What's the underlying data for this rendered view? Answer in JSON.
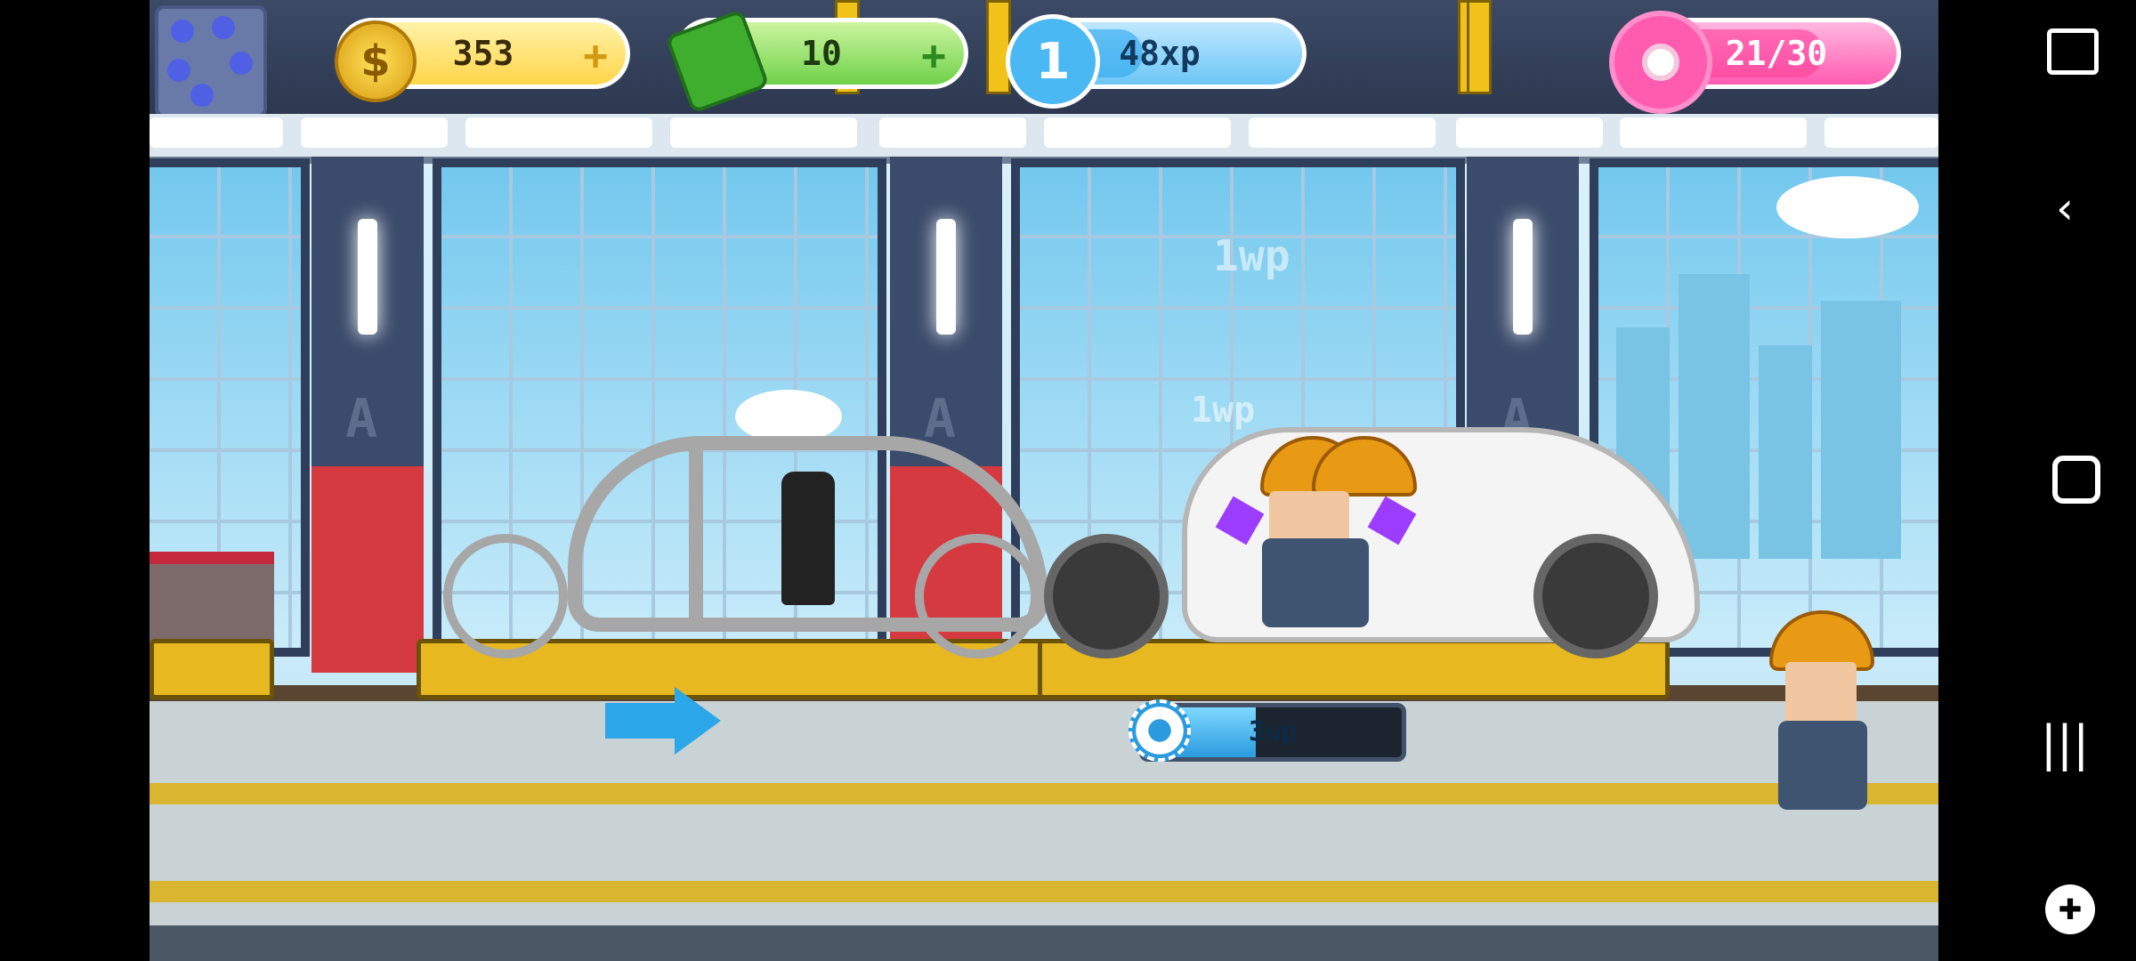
{
  "hud": {
    "coins": {
      "value": "353",
      "icon": "dollar-coin-icon",
      "plus": "+"
    },
    "cash": {
      "value": "10",
      "icon": "cash-bill-icon",
      "plus": "+"
    },
    "level": {
      "number": "1",
      "xp_label": "48xp",
      "xp_progress": 0.35
    },
    "donuts": {
      "value": "21/30",
      "progress": 0.7
    }
  },
  "world": {
    "floating_labels": [
      "1wp",
      "1wp"
    ],
    "assembly_progress": {
      "label": "3wp",
      "fraction": 0.45
    }
  },
  "colors": {
    "coin": "#ffd64a",
    "cash": "#6fd24a",
    "xp": "#6cc6f5",
    "donut": "#ff5cb0",
    "pillar_red": "#d43a40",
    "cart_yellow": "#e8b821"
  },
  "system_nav": {
    "buttons": [
      "screenshot-icon",
      "back-icon",
      "home-icon",
      "recents-icon",
      "game-tools-icon"
    ]
  }
}
